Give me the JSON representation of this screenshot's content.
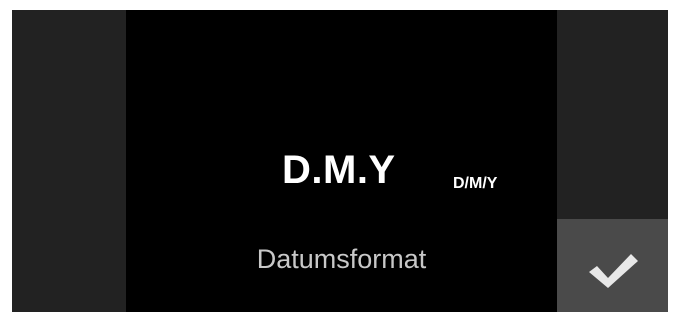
{
  "setting": {
    "value_main": "D.M.Y",
    "value_sub": "D/M/Y",
    "label": "Datumsformat"
  },
  "confirm": {
    "icon": "checkmark-icon"
  },
  "colors": {
    "background": "#000000",
    "side_panel": "#222222",
    "confirm_button": "#4a4a4a",
    "text_primary": "#ffffff",
    "text_label": "#c8c8c8"
  }
}
